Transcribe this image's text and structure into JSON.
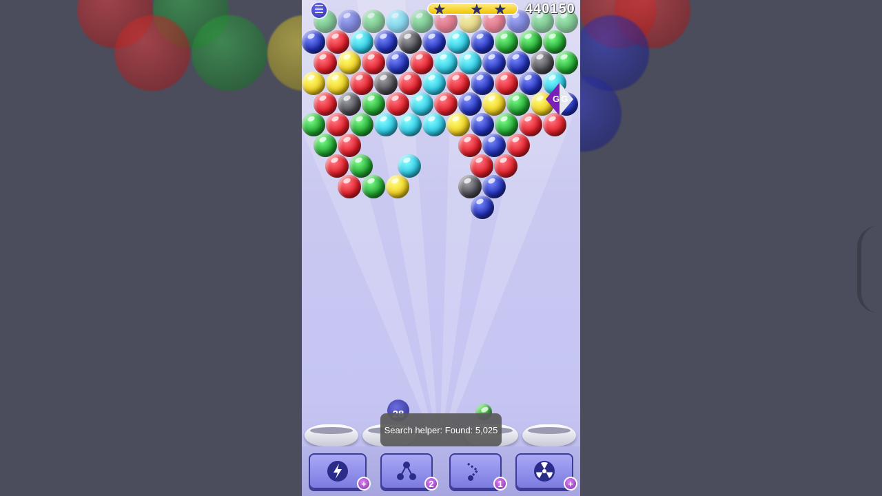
{
  "game": {
    "menu_icon": "hamburger-icon",
    "score": "440150",
    "progress_percent": 100,
    "stars": 3,
    "shot_counter": "28",
    "overlay_label": "GG"
  },
  "boosters": [
    {
      "name": "lightning",
      "icon": "lightning-ball-icon",
      "count": "+"
    },
    {
      "name": "triangle",
      "icon": "triangle-spread-icon",
      "count": "2"
    },
    {
      "name": "aim",
      "icon": "aim-line-icon",
      "count": "1"
    },
    {
      "name": "bomb",
      "icon": "radiation-icon",
      "count": "+"
    }
  ],
  "toast": {
    "text": "Search helper: Found: 5,025"
  },
  "colors": {
    "red": "#e21f2a",
    "green": "#22a631",
    "blue": "#2231b8",
    "cyan": "#2ec8e4",
    "yellow": "#f0d021",
    "gray": "#4b4b52"
  }
}
